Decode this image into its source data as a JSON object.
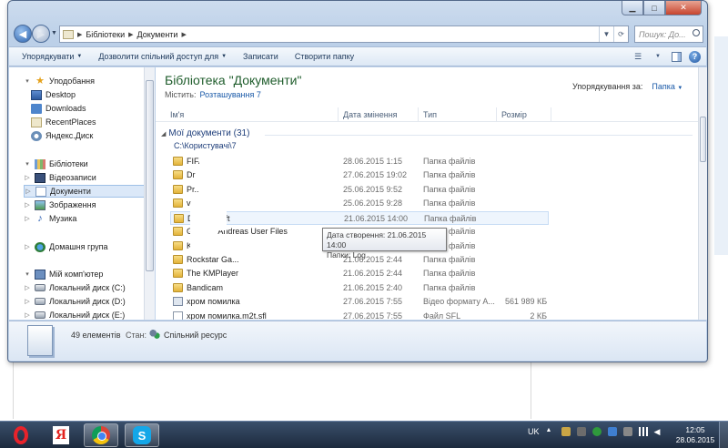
{
  "address": {
    "crumbs": [
      "Бібліотеки",
      "Документи"
    ],
    "search_placeholder": "Пошук: До..."
  },
  "toolbar": {
    "organize": "Упорядкувати",
    "share": "Дозволити спільний доступ для",
    "burn": "Записати",
    "new_folder": "Створити папку"
  },
  "nav": {
    "favorites": "Уподобання",
    "desktop": "Desktop",
    "downloads": "Downloads",
    "recent": "RecentPlaces",
    "yandex": "Яндекс.Диск",
    "libraries": "Бібліотеки",
    "videos": "Відеозаписи",
    "documents": "Документи",
    "pictures": "Зображення",
    "music": "Музика",
    "homegroup": "Домашня група",
    "computer": "Мій комп'ютер",
    "disk_c": "Локальний диск (C:)",
    "disk_d": "Локальний диск (D:)",
    "disk_e": "Локальний диск (E:)"
  },
  "library": {
    "title": "Бібліотека \"Документи\"",
    "includes_label": "Містить:",
    "includes_link": "Розташування 7",
    "sort_label": "Упорядкування за:",
    "sort_value": "Папка"
  },
  "columns": {
    "name": "Ім'я",
    "date": "Дата змінення",
    "type": "Тип",
    "size": "Розмір"
  },
  "group": {
    "title": "Мої документи (31)",
    "path": "C:\\Користувачі\\7"
  },
  "files": [
    {
      "name": "FIFA",
      "date": "28.06.2015 1:15",
      "type": "Папка файлів",
      "size": "",
      "icon": "folder"
    },
    {
      "name": "Dr",
      "date": "27.06.2015 19:02",
      "type": "Папка файлів",
      "size": "",
      "icon": "folder"
    },
    {
      "name": "Pr...RS",
      "date": "25.06.2015 9:52",
      "type": "Папка файлів",
      "size": "",
      "icon": "folder"
    },
    {
      "name": "v",
      "date": "25.06.2015 9:28",
      "type": "Папка файлів",
      "size": "",
      "icon": "folder"
    },
    {
      "name": "Drea...osoft",
      "date": "21.06.2015 14:00",
      "type": "Папка файлів",
      "size": "",
      "icon": "folder"
    },
    {
      "name": "GTA ...n Andreas User Files",
      "date": "21.06.2015 2:44",
      "type": "Папка файлів",
      "size": "",
      "icon": "folder"
    },
    {
      "name": "Ku",
      "date": "21.06.2015 2:44",
      "type": "Папка файлів",
      "size": "",
      "icon": "folder"
    },
    {
      "name": "Rockstar Ga...",
      "date": "21.06.2015 2:44",
      "type": "Папка файлів",
      "size": "",
      "icon": "folder"
    },
    {
      "name": "The KMPlayer",
      "date": "21.06.2015 2:44",
      "type": "Папка файлів",
      "size": "",
      "icon": "folder"
    },
    {
      "name": "Bandicam",
      "date": "21.06.2015 2:40",
      "type": "Папка файлів",
      "size": "",
      "icon": "folder"
    },
    {
      "name": "хром помилка",
      "date": "27.06.2015 7:55",
      "type": "Відео формату А...",
      "size": "561 989 КБ",
      "icon": "video"
    },
    {
      "name": "хром помилка.m2t.sfl",
      "date": "27.06.2015 7:55",
      "type": "Файл SFL",
      "size": "2 КБ",
      "icon": "sfl"
    }
  ],
  "tooltip": {
    "line1": "Дата створення: 21.06.2015 14:00",
    "line2": "Папки: Log"
  },
  "details": {
    "count": "49 елементів",
    "state_label": "Стан:",
    "state_value": "Спільний ресурс"
  },
  "taskbar": {
    "apps": [
      "opera-icon",
      "yandex-browser-icon",
      "chrome-icon",
      "skype-icon"
    ],
    "yandex_glyph": "Я",
    "skype_glyph": "S",
    "lang": "UK",
    "time": "12:05",
    "date": "28.06.2015"
  }
}
